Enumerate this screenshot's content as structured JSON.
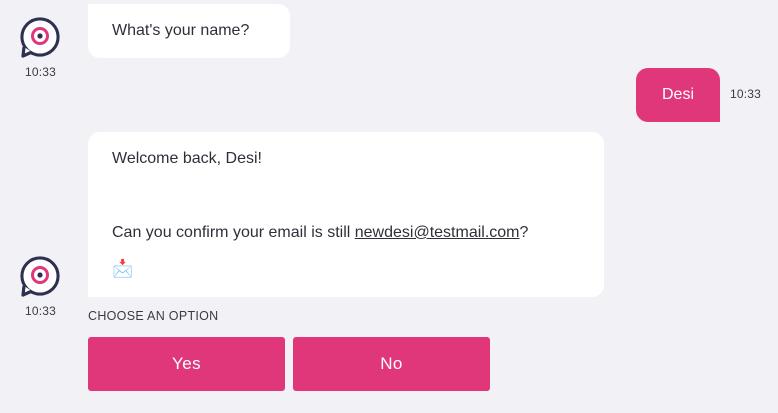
{
  "messages": {
    "bot_question": {
      "text": "What's your name?",
      "time": "10:33"
    },
    "user_reply": {
      "text": "Desi",
      "time": "10:33"
    },
    "bot_welcome": {
      "line1": "Welcome back, Desi!",
      "line2_prefix": "Can you confirm your email is still ",
      "email": "newdesi@testmail.com",
      "line2_suffix": "?",
      "emoji": "📩",
      "time": "10:33"
    }
  },
  "options": {
    "label": "CHOOSE AN OPTION",
    "yes": "Yes",
    "no": "No"
  },
  "colors": {
    "accent": "#e0377b",
    "background": "#f2f2f6",
    "bubble_bot": "#ffffff",
    "avatar_outline": "#2e3050"
  },
  "icons": {
    "bot_avatar": "chat-bubble-eye-icon"
  }
}
